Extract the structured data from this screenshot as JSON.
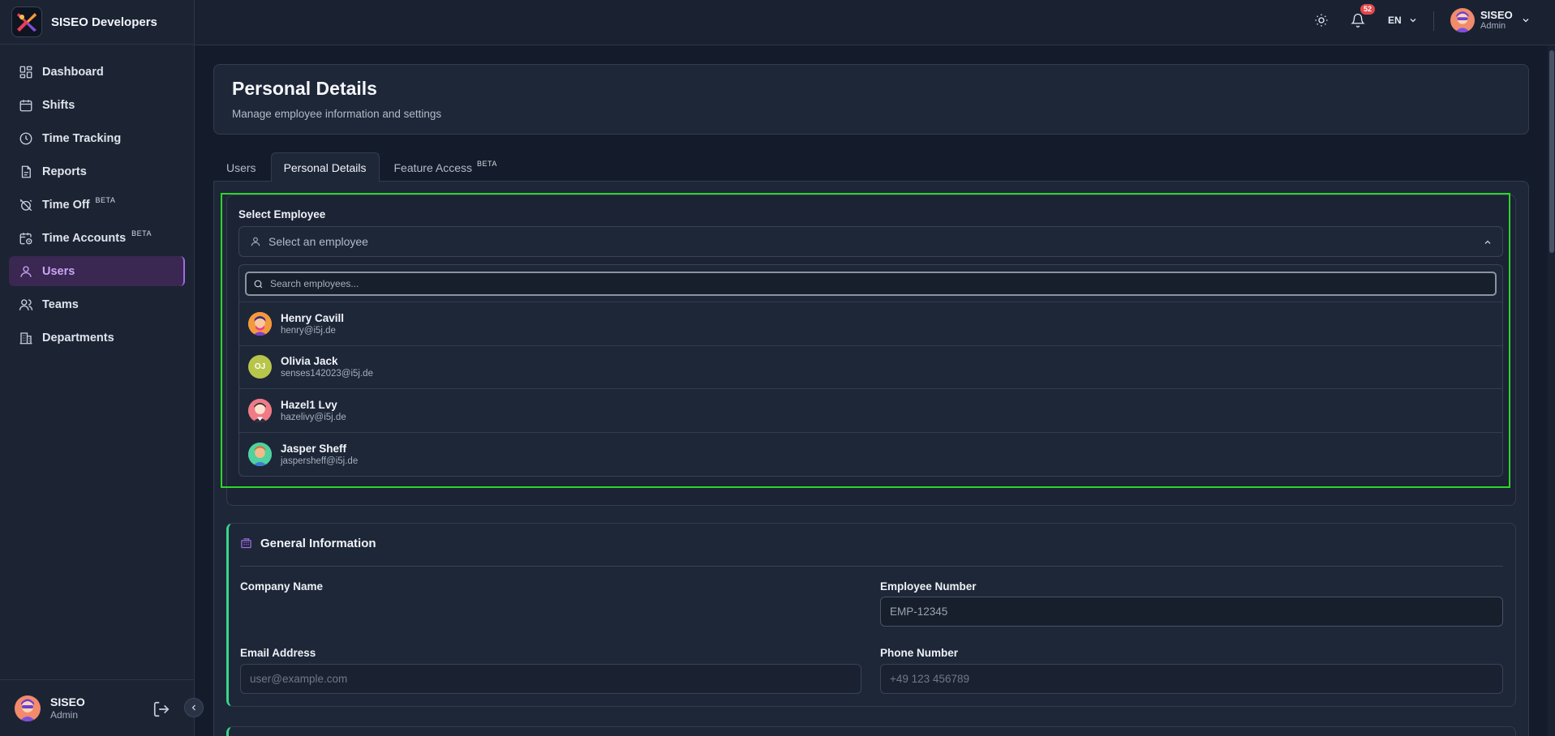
{
  "brand": {
    "name": "SISEO Developers"
  },
  "sidebar": {
    "items": [
      {
        "label": "Dashboard",
        "icon": "dashboard-icon",
        "beta": ""
      },
      {
        "label": "Shifts",
        "icon": "calendar-icon",
        "beta": ""
      },
      {
        "label": "Time Tracking",
        "icon": "clock-icon",
        "beta": ""
      },
      {
        "label": "Reports",
        "icon": "report-icon",
        "beta": ""
      },
      {
        "label": "Time Off",
        "icon": "alarm-off-icon",
        "beta": "BETA"
      },
      {
        "label": "Time Accounts",
        "icon": "calendar-clock-icon",
        "beta": "BETA"
      },
      {
        "label": "Users",
        "icon": "user-icon",
        "beta": "",
        "active": true
      },
      {
        "label": "Teams",
        "icon": "users-icon",
        "beta": ""
      },
      {
        "label": "Departments",
        "icon": "building-icon",
        "beta": ""
      }
    ],
    "user": {
      "name": "SISEO",
      "role": "Admin"
    }
  },
  "topbar": {
    "notification_count": "52",
    "language": "EN",
    "user": {
      "name": "SISEO",
      "role": "Admin"
    }
  },
  "header": {
    "title": "Personal Details",
    "subtitle": "Manage employee information and settings"
  },
  "tabs": [
    {
      "label": "Users",
      "beta": ""
    },
    {
      "label": "Personal Details",
      "beta": "",
      "active": true
    },
    {
      "label": "Feature Access",
      "beta": "BETA"
    }
  ],
  "employee_select": {
    "label": "Select Employee",
    "placeholder": "Select an employee",
    "search_placeholder": "Search employees...",
    "employees": [
      {
        "name": "Henry Cavill",
        "email": "henry@i5j.de",
        "initials": "",
        "avatar_color": "#f39a3c"
      },
      {
        "name": "Olivia Jack",
        "email": "senses142023@i5j.de",
        "initials": "OJ",
        "avatar_color": "#b7c64a"
      },
      {
        "name": "Hazel1 Lvy",
        "email": "hazelivy@i5j.de",
        "initials": "",
        "avatar_color": "#f07a86"
      },
      {
        "name": "Jasper Sheff",
        "email": "jaspersheff@i5j.de",
        "initials": "",
        "avatar_color": "#4fd1a0"
      }
    ]
  },
  "general_info": {
    "title": "General Information",
    "company_name_label": "Company Name",
    "employee_number_label": "Employee Number",
    "employee_number_placeholder": "EMP-12345",
    "email_label": "Email Address",
    "email_placeholder": "user@example.com",
    "phone_label": "Phone Number",
    "phone_placeholder": "+49 123 456789"
  },
  "colors": {
    "accent_purple": "#a06be3",
    "highlight_green": "#2fd52a",
    "section_accent": "#3ad58a",
    "badge_red": "#e5484d"
  }
}
